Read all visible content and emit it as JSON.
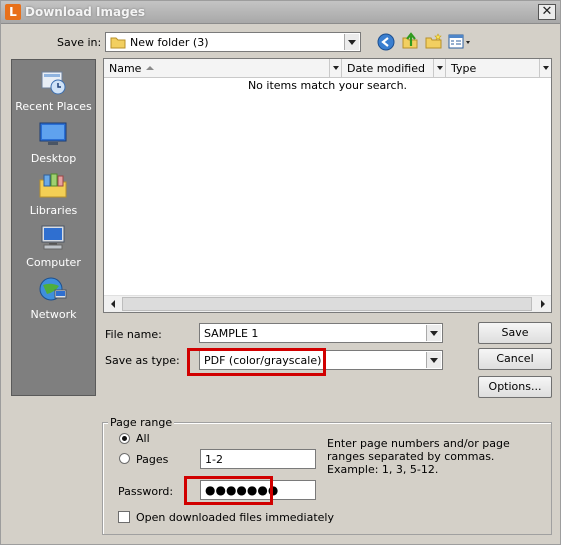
{
  "window": {
    "title": "Download Images",
    "app_icon_letter": "L"
  },
  "save_in": {
    "label": "Save in:",
    "value": "New folder (3)"
  },
  "toolbar": {
    "back_icon": "back-arrow-icon",
    "up_icon": "up-folder-icon",
    "new_folder_icon": "new-folder-icon",
    "views_icon": "view-menu-icon"
  },
  "places": [
    {
      "label": "Recent Places",
      "icon": "recent-places-icon"
    },
    {
      "label": "Desktop",
      "icon": "desktop-icon"
    },
    {
      "label": "Libraries",
      "icon": "libraries-icon"
    },
    {
      "label": "Computer",
      "icon": "computer-icon"
    },
    {
      "label": "Network",
      "icon": "network-icon"
    }
  ],
  "file_list": {
    "columns": [
      "Name",
      "Date modified",
      "Type"
    ],
    "empty_message": "No items match your search."
  },
  "file_name": {
    "label": "File name:",
    "value": "SAMPLE 1"
  },
  "save_as_type": {
    "label": "Save as type:",
    "value": "PDF (color/grayscale)"
  },
  "buttons": {
    "save": "Save",
    "cancel": "Cancel",
    "options": "Options..."
  },
  "page_range": {
    "title": "Page range",
    "all_label": "All",
    "pages_label": "Pages",
    "pages_value": "1-2",
    "selected": "All",
    "hint": "Enter page numbers and/or page ranges separated by commas. Example: 1, 3, 5-12."
  },
  "password": {
    "label": "Password:",
    "masked_value": "●●●●●●●"
  },
  "open_after": {
    "label": "Open downloaded files immediately",
    "checked": false
  },
  "colors": {
    "highlight": "#d10000",
    "places_bg": "#7f7f7f",
    "dialog_bg": "#d4d0c8"
  }
}
